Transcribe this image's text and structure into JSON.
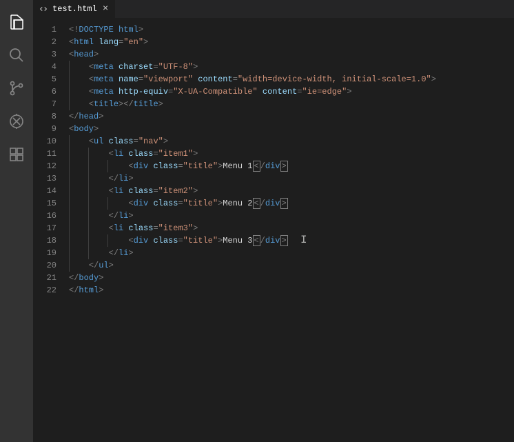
{
  "tab": {
    "filename": "test.html"
  },
  "gutter": {
    "start": 1,
    "end": 22
  },
  "code": {
    "l1": {
      "doctype_bang": "!",
      "doctype_word": "DOCTYPE",
      "doctype_root": "html"
    },
    "l2": {
      "tag": "html",
      "attr": "lang",
      "val": "\"en\""
    },
    "l3": {
      "tag": "head"
    },
    "l4": {
      "tag": "meta",
      "attr": "charset",
      "val": "\"UTF-8\""
    },
    "l5": {
      "tag": "meta",
      "a1": "name",
      "v1": "\"viewport\"",
      "a2": "content",
      "v2": "\"width=device-width, initial-scale=1.0\""
    },
    "l6": {
      "tag": "meta",
      "a1": "http-equiv",
      "v1": "\"X-UA-Compatible\"",
      "a2": "content",
      "v2": "\"ie=edge\""
    },
    "l7": {
      "tag": "title"
    },
    "l8": {
      "tag": "head"
    },
    "l9": {
      "tag": "body"
    },
    "l10": {
      "tag": "ul",
      "attr": "class",
      "val": "\"nav\""
    },
    "l11": {
      "tag": "li",
      "attr": "class",
      "val": "\"item1\""
    },
    "l12": {
      "tag": "div",
      "attr": "class",
      "val": "\"title\"",
      "text": "Menu 1"
    },
    "l13": {
      "tag": "li"
    },
    "l14": {
      "tag": "li",
      "attr": "class",
      "val": "\"item2\""
    },
    "l15": {
      "tag": "div",
      "attr": "class",
      "val": "\"title\"",
      "text": "Menu 2"
    },
    "l16": {
      "tag": "li"
    },
    "l17": {
      "tag": "li",
      "attr": "class",
      "val": "\"item3\""
    },
    "l18": {
      "tag": "div",
      "attr": "class",
      "val": "\"title\"",
      "text": "Menu 3"
    },
    "l19": {
      "tag": "li"
    },
    "l20": {
      "tag": "ul"
    },
    "l21": {
      "tag": "body"
    },
    "l22": {
      "tag": "html"
    }
  }
}
